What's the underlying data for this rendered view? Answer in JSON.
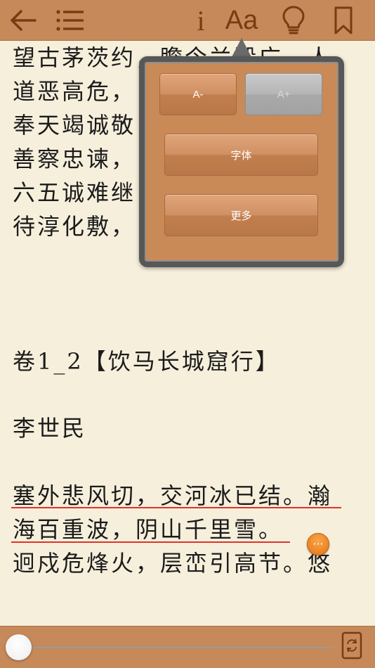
{
  "toolbar": {
    "back_icon": "back-arrow-icon",
    "toc_icon": "list-icon",
    "info_label": "i",
    "font_label": "Aa",
    "tip_icon": "lightbulb-icon",
    "bookmark_icon": "bookmark-icon"
  },
  "reader": {
    "lines": [
      "望古茅茨约，瞻今兰殿广。人",
      "道恶高危，",
      "奉天竭诚敬",
      "善察忠谏，",
      "六五诚难继",
      "待淳化敷，",
      "卷1_2【饮马长城窟行】",
      "李世民",
      "塞外悲风切，交河冰已结。瀚",
      "海百重波，阴山千里雪。",
      "迥戍危烽火，层峦引高节。悠"
    ],
    "highlight_color": "#e0322c"
  },
  "popup": {
    "decrease_label": "A-",
    "increase_label": "A+",
    "font_label": "字体",
    "more_label": "更多"
  },
  "fab": {
    "label": "···",
    "color": "#f08a26"
  },
  "bottombar": {
    "progress": 0.0,
    "rotate_icon": "rotate-screen-icon"
  },
  "colors": {
    "bar": "#c6895a",
    "paper": "#f6efdc",
    "icon": "#7a3b12"
  }
}
